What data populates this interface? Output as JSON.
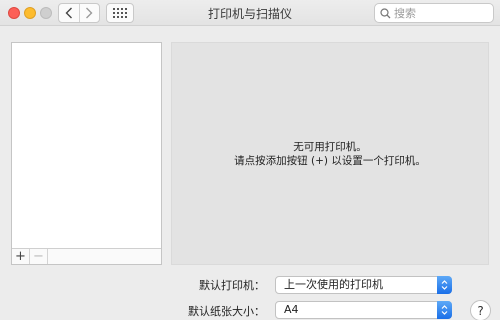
{
  "window": {
    "title": "打印机与扫描仪",
    "search_placeholder": "搜索"
  },
  "list": {
    "add_label": "+",
    "remove_label": "−"
  },
  "detail": {
    "line1": "无可用打印机。",
    "line2": "请点按添加按钮 (+) 以设置一个打印机。"
  },
  "settings": {
    "default_printer_label": "默认打印机：",
    "default_printer_value": "上一次使用的打印机",
    "paper_size_label": "默认纸张大小：",
    "paper_size_value": "A4"
  },
  "help_label": "?",
  "colors": {
    "close": "#fc5f57",
    "minimize": "#fdbc2e",
    "zoom": "#cfcfcf",
    "accent": "#1a6fe8"
  }
}
